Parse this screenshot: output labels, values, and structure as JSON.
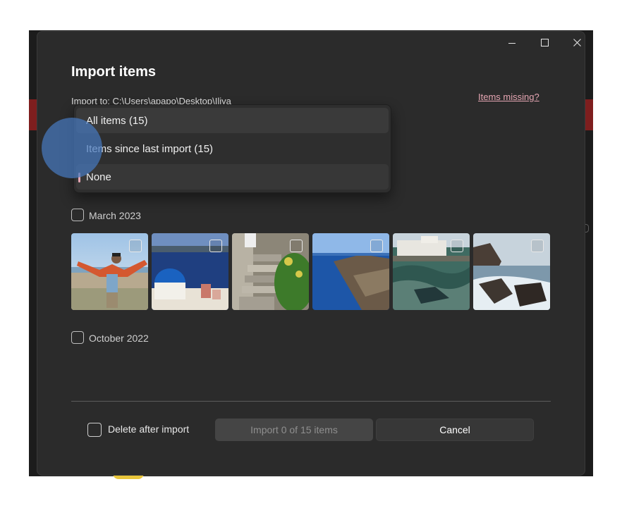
{
  "dialog": {
    "title": "Import items",
    "import_to": "Import to:  C:\\Users\\apapo\\Desktop\\Iliya",
    "items_missing_link": "Items missing?",
    "window_controls": {
      "minimize_icon": "minimize-icon",
      "maximize_icon": "maximize-icon",
      "close_icon": "close-icon"
    }
  },
  "selection_dropdown": {
    "options": [
      {
        "label": "All items (15)"
      },
      {
        "label": "Items since last import (15)"
      },
      {
        "label": "None",
        "selected": true
      }
    ]
  },
  "groups": [
    {
      "label": "March 2023",
      "checked": false,
      "photos": [
        {
          "subject": "man with arms outstretched on cliff",
          "checked": false
        },
        {
          "subject": "blue dome church and sea",
          "checked": false
        },
        {
          "subject": "stone stairway with plants",
          "checked": false
        },
        {
          "subject": "blue sea and coastline cliffs",
          "checked": false
        },
        {
          "subject": "waves and harbor buildings",
          "checked": false
        },
        {
          "subject": "rocky shore with crashing waves",
          "checked": false
        }
      ]
    },
    {
      "label": "October 2022",
      "checked": false,
      "photos": []
    }
  ],
  "footer": {
    "delete_after_import_label": "Delete after import",
    "delete_after_import_checked": false,
    "import_button_label": "Import 0 of 15 items",
    "cancel_button_label": "Cancel"
  },
  "colors": {
    "dialog_bg": "#2b2b2b",
    "accent_pink": "#e6a6b3",
    "touch_indicator": "#4678be"
  }
}
